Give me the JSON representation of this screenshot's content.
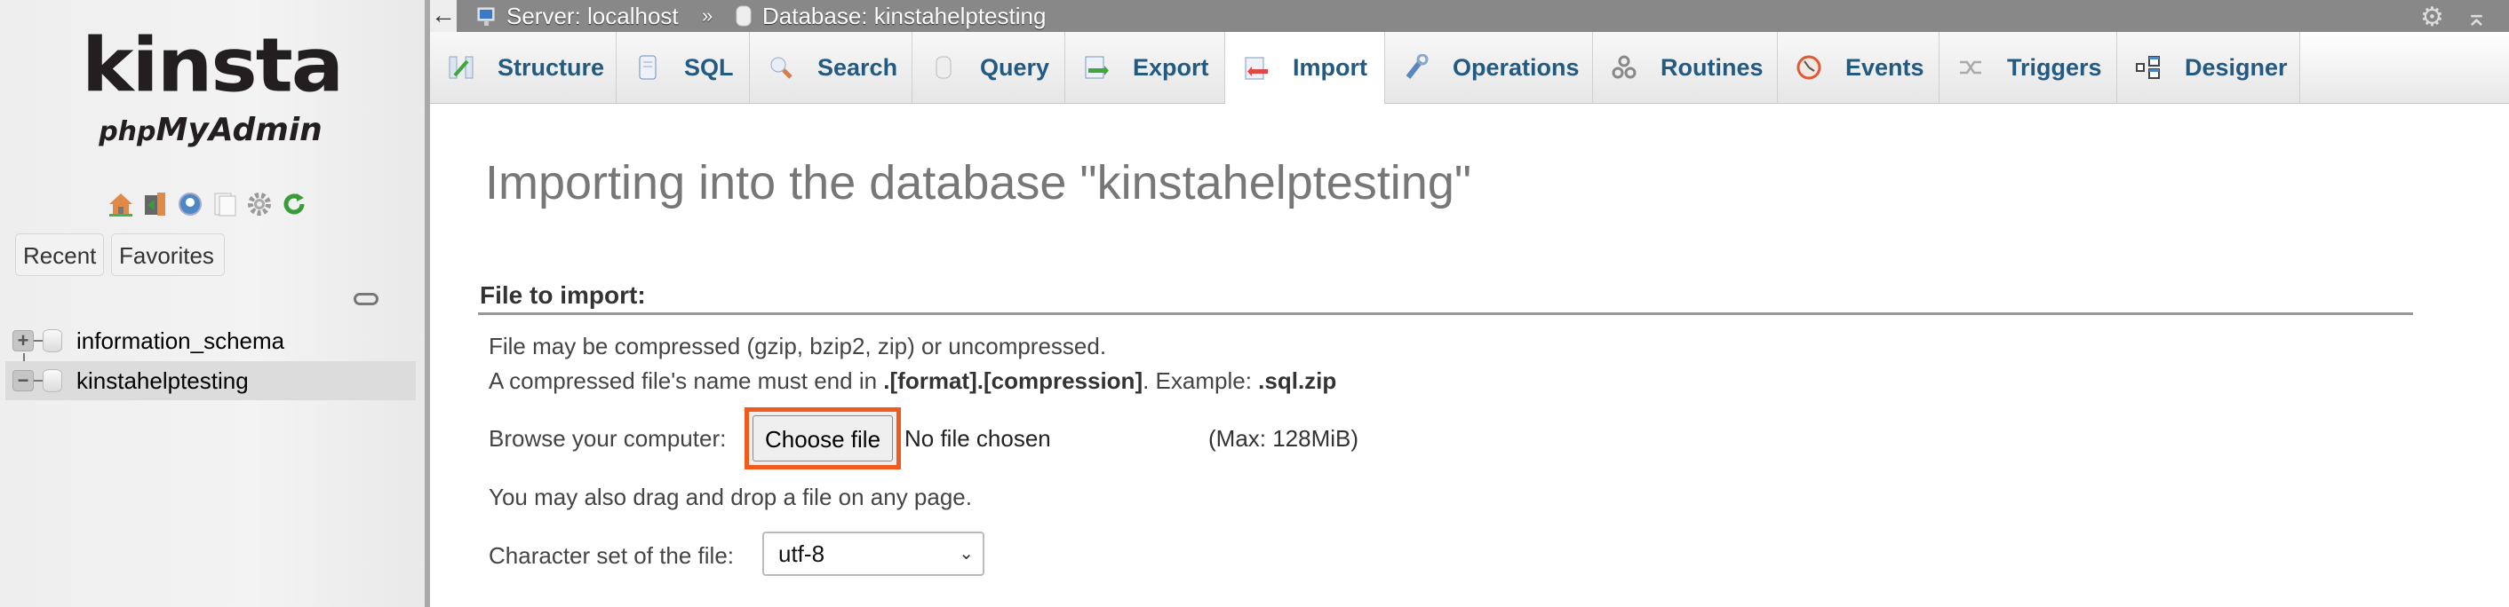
{
  "sidebar": {
    "logo_main": "kinsta",
    "logo_sub_php": "php",
    "logo_sub_rest": "MyAdmin",
    "nav_icons": [
      "home-icon",
      "logout-icon",
      "help-icon",
      "docs-icon",
      "settings-icon",
      "reload-icon"
    ],
    "recent_label": "Recent",
    "favorites_label": "Favorites",
    "databases": [
      {
        "name": "information_schema",
        "toggle": "+",
        "selected": false
      },
      {
        "name": "kinstahelptesting",
        "toggle": "−",
        "selected": true
      }
    ]
  },
  "topbar": {
    "back_glyph": "←",
    "server_label": "Server: localhost",
    "separator": "»",
    "database_label": "Database: kinstahelptesting"
  },
  "tabs": [
    {
      "label": "Structure",
      "icon": "structure-icon",
      "active": false
    },
    {
      "label": "SQL",
      "icon": "sql-icon",
      "active": false
    },
    {
      "label": "Search",
      "icon": "search-icon",
      "active": false
    },
    {
      "label": "Query",
      "icon": "query-icon",
      "active": false
    },
    {
      "label": "Export",
      "icon": "export-icon",
      "active": false
    },
    {
      "label": "Import",
      "icon": "import-icon",
      "active": true
    },
    {
      "label": "Operations",
      "icon": "operations-icon",
      "active": false
    },
    {
      "label": "Routines",
      "icon": "routines-icon",
      "active": false
    },
    {
      "label": "Events",
      "icon": "events-icon",
      "active": false
    },
    {
      "label": "Triggers",
      "icon": "triggers-icon",
      "active": false
    },
    {
      "label": "Designer",
      "icon": "designer-icon",
      "active": false
    }
  ],
  "main": {
    "title": "Importing into the database \"kinstahelptesting\"",
    "section_title": "File to import:",
    "line1": "File may be compressed (gzip, bzip2, zip) or uncompressed.",
    "line2_prefix": "A compressed file's name must end in ",
    "line2_bold1": ".[format].[compression]",
    "line2_mid": ". Example: ",
    "line2_bold2": ".sql.zip",
    "browse_label": "Browse your computer:",
    "choose_file_label": "Choose file",
    "no_file_text": "No file chosen",
    "max_size": "(Max: 128MiB)",
    "drag_text": "You may also drag and drop a file on any page.",
    "charset_label": "Character set of the file:",
    "charset_value": "utf-8"
  },
  "colors": {
    "highlight_border": "#f05a1d",
    "tab_text": "#235a81",
    "topbar_bg": "#888888"
  }
}
